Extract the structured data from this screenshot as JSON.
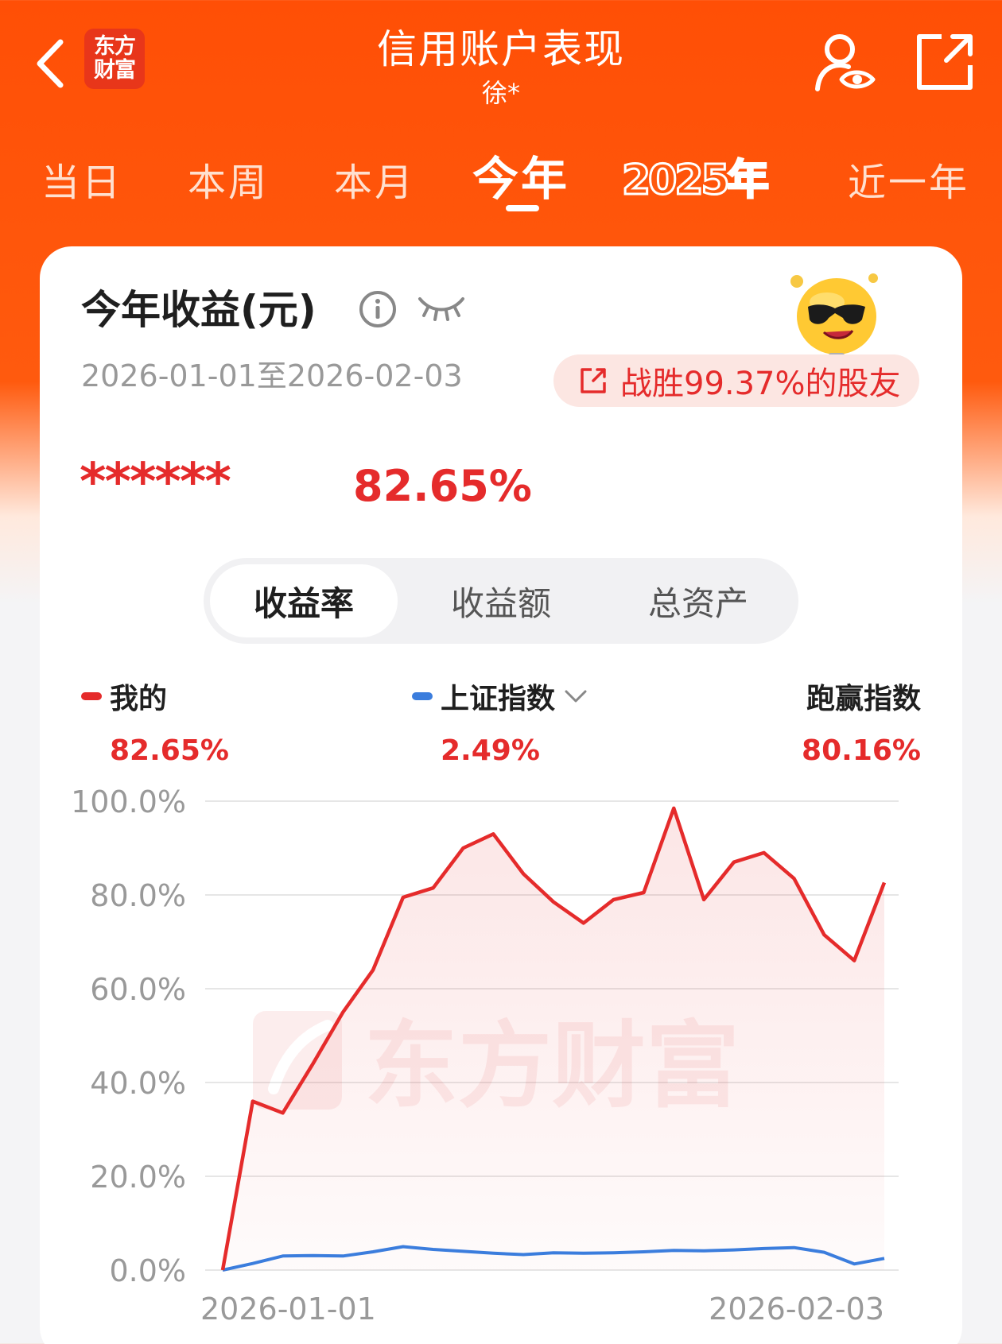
{
  "header": {
    "title": "信用账户表现",
    "subtitle": "徐*",
    "logo_line1": "东方",
    "logo_line2": "财富"
  },
  "period_tabs": [
    {
      "label": "当日",
      "active": false
    },
    {
      "label": "本周",
      "active": false
    },
    {
      "label": "本月",
      "active": false
    },
    {
      "label": "今年",
      "active": true
    },
    {
      "label": "2025年",
      "active": false
    },
    {
      "label": "近一年",
      "active": false
    }
  ],
  "card": {
    "title": "今年收益(元)",
    "date_range": "2026-01-01至2026-02-03",
    "beat_text": "战胜99.37%的股友",
    "masked_amount": "******",
    "return_pct": "82.65%"
  },
  "segments": [
    {
      "label": "收益率",
      "active": true
    },
    {
      "label": "收益额",
      "active": false
    },
    {
      "label": "总资产",
      "active": false
    }
  ],
  "legend": {
    "mine": {
      "name": "我的",
      "value": "82.65%"
    },
    "index": {
      "name": "上证指数",
      "value": "2.49%"
    },
    "beat": {
      "name": "跑赢指数",
      "value": "80.16%"
    }
  },
  "colors": {
    "brand": "#FF5208",
    "mine": "#E52B2B",
    "index": "#3B7DDD"
  },
  "chart_data": {
    "type": "line",
    "y_ticks": [
      "100.0%",
      "80.0%",
      "60.0%",
      "40.0%",
      "20.0%",
      "0.0%"
    ],
    "ylim": [
      0,
      100
    ],
    "x_tick_labels": [
      "2026-01-01",
      "2026-02-03"
    ],
    "watermark": "东方财富",
    "series": [
      {
        "name": "我的",
        "values": [
          0,
          36,
          33.5,
          44,
          55,
          64,
          79.5,
          81.5,
          90,
          93,
          84.5,
          78.5,
          74,
          79,
          80.5,
          98.5,
          79,
          87,
          89,
          83.5,
          71.5,
          66,
          82.65
        ]
      },
      {
        "name": "上证指数",
        "values": [
          0,
          1.4,
          3,
          3.1,
          3,
          3.9,
          5,
          4.4,
          4,
          3.6,
          3.3,
          3.7,
          3.6,
          3.7,
          3.9,
          4.2,
          4.1,
          4.3,
          4.6,
          4.8,
          3.8,
          1.3,
          2.49
        ]
      }
    ]
  }
}
